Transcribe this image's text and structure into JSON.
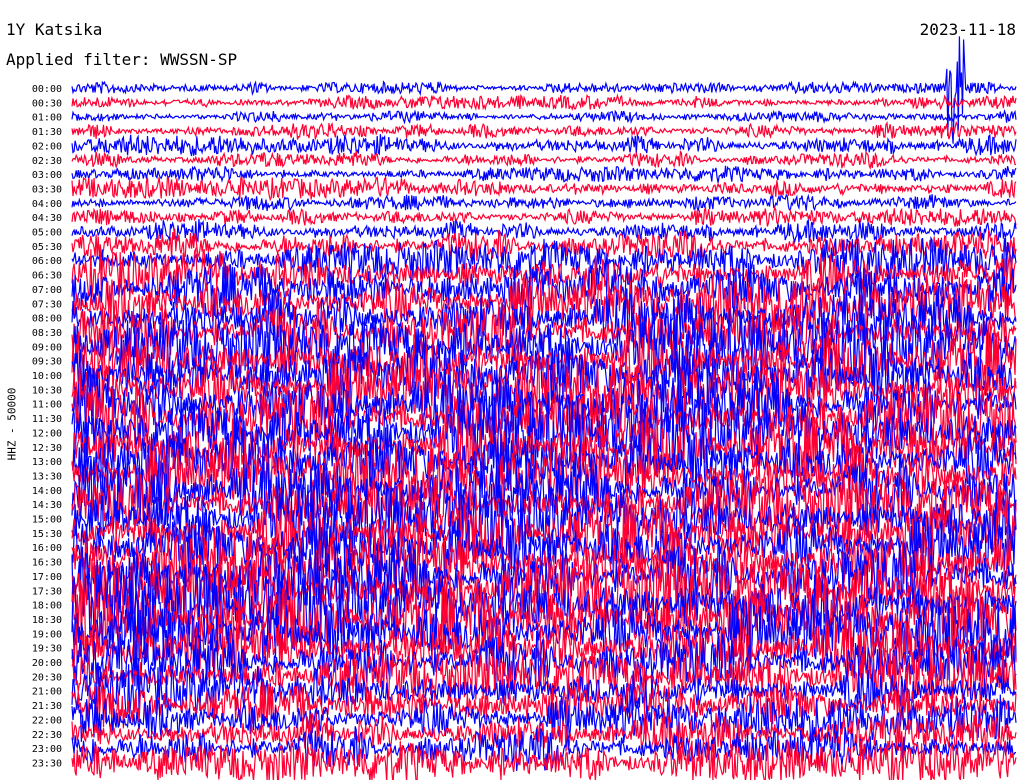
{
  "header": {
    "station": "1Y Katsika",
    "date": "2023-11-18",
    "filter": "Applied filter: WWSSN-SP"
  },
  "chart_data": {
    "type": "line",
    "title": "1Y Katsika",
    "ylabel": "HHZ - 50000",
    "row_labels": [
      "00:00",
      "00:30",
      "01:00",
      "01:30",
      "02:00",
      "02:30",
      "03:00",
      "03:30",
      "04:00",
      "04:30",
      "05:00",
      "05:30",
      "06:00",
      "06:30",
      "07:00",
      "07:30",
      "08:00",
      "08:30",
      "09:00",
      "09:30",
      "10:00",
      "10:30",
      "11:00",
      "11:30",
      "12:00",
      "12:30",
      "13:00",
      "13:30",
      "14:00",
      "14:30",
      "15:00",
      "15:30",
      "16:00",
      "16:30",
      "17:00",
      "17:30",
      "18:00",
      "18:30",
      "19:00",
      "19:30",
      "20:00",
      "20:30",
      "21:00",
      "21:30",
      "22:00",
      "22:30",
      "23:00",
      "23:30"
    ],
    "colors": [
      "#0000ff",
      "#ff0033"
    ],
    "grid": false,
    "series_note": "alternating blue/red traces per row",
    "relative_amplitude": [
      0.5,
      0.6,
      0.5,
      0.7,
      0.9,
      0.7,
      0.7,
      0.9,
      0.7,
      0.8,
      1.0,
      1.4,
      1.8,
      2.1,
      2.3,
      2.5,
      2.6,
      2.7,
      2.8,
      2.9,
      3.0,
      3.0,
      3.1,
      3.1,
      3.1,
      3.1,
      3.0,
      3.0,
      3.0,
      2.9,
      2.9,
      3.0,
      3.1,
      3.2,
      3.2,
      3.3,
      3.3,
      3.3,
      3.2,
      3.0,
      2.7,
      2.4,
      2.2,
      2.0,
      2.0,
      1.9,
      1.9,
      1.8
    ],
    "events": [
      {
        "row": 0,
        "x_fraction": 0.936,
        "amplitude": 9
      }
    ]
  }
}
